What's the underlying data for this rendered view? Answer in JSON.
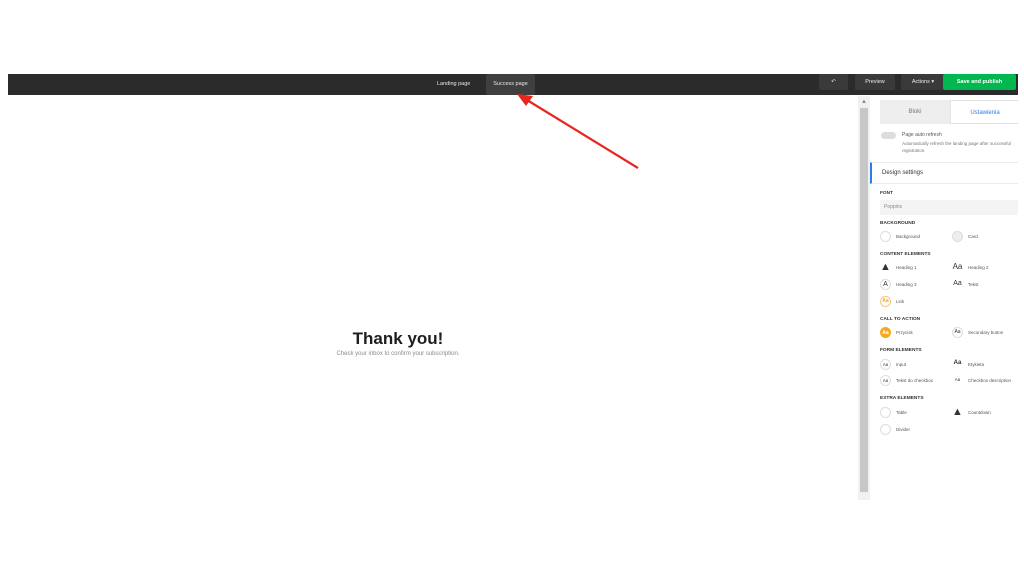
{
  "topbar": {
    "tabs": [
      {
        "label": "Landing page",
        "active": false
      },
      {
        "label": "Success page",
        "active": true
      }
    ],
    "undo_icon": "undo-icon",
    "preview_label": "Preview",
    "actions_label": "Actions ▾",
    "save_label": "Save and publish"
  },
  "canvas": {
    "title": "Thank you!",
    "subtitle": "Check your inbox to confirm your subscription."
  },
  "panel": {
    "tabs": [
      {
        "label": "Bloki",
        "active": false
      },
      {
        "label": "Ustawienia",
        "active": true
      }
    ],
    "auto_refresh_title": "Page auto refresh",
    "auto_refresh_desc": "Automatically refresh the landing page after successful registration.",
    "design_settings_label": "Design settings",
    "font_heading": "FONT",
    "font_value": "Poppins",
    "background_heading": "BACKGROUND",
    "background_items": [
      "Background",
      "Card"
    ],
    "content_heading": "CONTENT ELEMENTS",
    "content_items": [
      "Heading 1",
      "Heading 2",
      "Heading 3",
      "Tekst",
      "Link"
    ],
    "cta_heading": "CALL TO ACTION",
    "cta_items": [
      "Przycisk",
      "Secondary button"
    ],
    "form_heading": "FORM ELEMENTS",
    "form_items": [
      "Input",
      "Etykieta",
      "Tekst do checkbox",
      "Checkbox description"
    ],
    "extra_heading": "EXTRA ELEMENTS",
    "extra_items": [
      "Table",
      "Countdown",
      "Divider"
    ]
  },
  "colors": {
    "topbar": "#2b2b2b",
    "save_button": "#00b84f",
    "accent": "#2b7de9",
    "annotation_arrow": "#e8251f",
    "cta_swatch": "#f7a823"
  }
}
